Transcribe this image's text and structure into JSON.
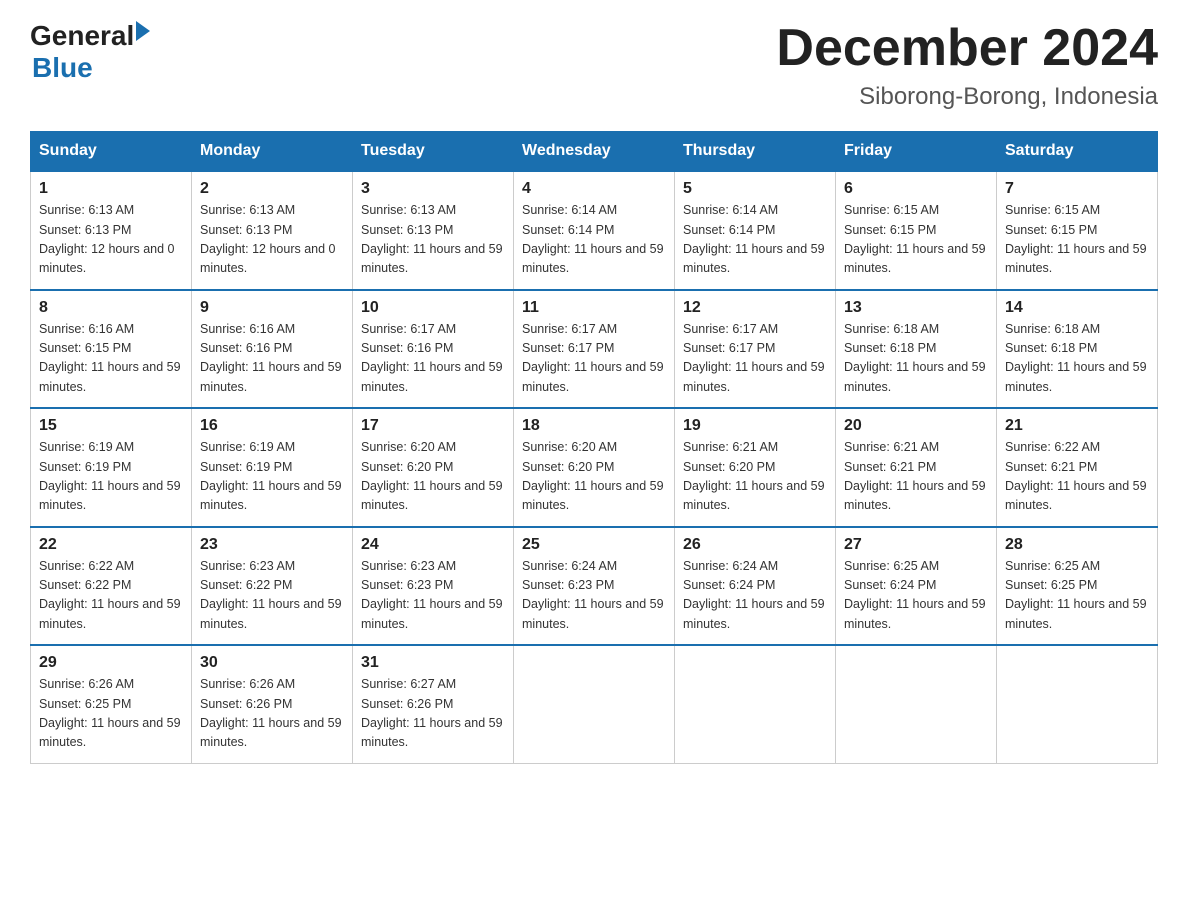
{
  "logo": {
    "general": "General",
    "arrow": "▶",
    "blue": "Blue"
  },
  "title": {
    "month": "December 2024",
    "location": "Siborong-Borong, Indonesia"
  },
  "headers": [
    "Sunday",
    "Monday",
    "Tuesday",
    "Wednesday",
    "Thursday",
    "Friday",
    "Saturday"
  ],
  "weeks": [
    [
      {
        "day": "1",
        "sunrise": "6:13 AM",
        "sunset": "6:13 PM",
        "daylight": "12 hours and 0 minutes."
      },
      {
        "day": "2",
        "sunrise": "6:13 AM",
        "sunset": "6:13 PM",
        "daylight": "12 hours and 0 minutes."
      },
      {
        "day": "3",
        "sunrise": "6:13 AM",
        "sunset": "6:13 PM",
        "daylight": "11 hours and 59 minutes."
      },
      {
        "day": "4",
        "sunrise": "6:14 AM",
        "sunset": "6:14 PM",
        "daylight": "11 hours and 59 minutes."
      },
      {
        "day": "5",
        "sunrise": "6:14 AM",
        "sunset": "6:14 PM",
        "daylight": "11 hours and 59 minutes."
      },
      {
        "day": "6",
        "sunrise": "6:15 AM",
        "sunset": "6:15 PM",
        "daylight": "11 hours and 59 minutes."
      },
      {
        "day": "7",
        "sunrise": "6:15 AM",
        "sunset": "6:15 PM",
        "daylight": "11 hours and 59 minutes."
      }
    ],
    [
      {
        "day": "8",
        "sunrise": "6:16 AM",
        "sunset": "6:15 PM",
        "daylight": "11 hours and 59 minutes."
      },
      {
        "day": "9",
        "sunrise": "6:16 AM",
        "sunset": "6:16 PM",
        "daylight": "11 hours and 59 minutes."
      },
      {
        "day": "10",
        "sunrise": "6:17 AM",
        "sunset": "6:16 PM",
        "daylight": "11 hours and 59 minutes."
      },
      {
        "day": "11",
        "sunrise": "6:17 AM",
        "sunset": "6:17 PM",
        "daylight": "11 hours and 59 minutes."
      },
      {
        "day": "12",
        "sunrise": "6:17 AM",
        "sunset": "6:17 PM",
        "daylight": "11 hours and 59 minutes."
      },
      {
        "day": "13",
        "sunrise": "6:18 AM",
        "sunset": "6:18 PM",
        "daylight": "11 hours and 59 minutes."
      },
      {
        "day": "14",
        "sunrise": "6:18 AM",
        "sunset": "6:18 PM",
        "daylight": "11 hours and 59 minutes."
      }
    ],
    [
      {
        "day": "15",
        "sunrise": "6:19 AM",
        "sunset": "6:19 PM",
        "daylight": "11 hours and 59 minutes."
      },
      {
        "day": "16",
        "sunrise": "6:19 AM",
        "sunset": "6:19 PM",
        "daylight": "11 hours and 59 minutes."
      },
      {
        "day": "17",
        "sunrise": "6:20 AM",
        "sunset": "6:20 PM",
        "daylight": "11 hours and 59 minutes."
      },
      {
        "day": "18",
        "sunrise": "6:20 AM",
        "sunset": "6:20 PM",
        "daylight": "11 hours and 59 minutes."
      },
      {
        "day": "19",
        "sunrise": "6:21 AM",
        "sunset": "6:20 PM",
        "daylight": "11 hours and 59 minutes."
      },
      {
        "day": "20",
        "sunrise": "6:21 AM",
        "sunset": "6:21 PM",
        "daylight": "11 hours and 59 minutes."
      },
      {
        "day": "21",
        "sunrise": "6:22 AM",
        "sunset": "6:21 PM",
        "daylight": "11 hours and 59 minutes."
      }
    ],
    [
      {
        "day": "22",
        "sunrise": "6:22 AM",
        "sunset": "6:22 PM",
        "daylight": "11 hours and 59 minutes."
      },
      {
        "day": "23",
        "sunrise": "6:23 AM",
        "sunset": "6:22 PM",
        "daylight": "11 hours and 59 minutes."
      },
      {
        "day": "24",
        "sunrise": "6:23 AM",
        "sunset": "6:23 PM",
        "daylight": "11 hours and 59 minutes."
      },
      {
        "day": "25",
        "sunrise": "6:24 AM",
        "sunset": "6:23 PM",
        "daylight": "11 hours and 59 minutes."
      },
      {
        "day": "26",
        "sunrise": "6:24 AM",
        "sunset": "6:24 PM",
        "daylight": "11 hours and 59 minutes."
      },
      {
        "day": "27",
        "sunrise": "6:25 AM",
        "sunset": "6:24 PM",
        "daylight": "11 hours and 59 minutes."
      },
      {
        "day": "28",
        "sunrise": "6:25 AM",
        "sunset": "6:25 PM",
        "daylight": "11 hours and 59 minutes."
      }
    ],
    [
      {
        "day": "29",
        "sunrise": "6:26 AM",
        "sunset": "6:25 PM",
        "daylight": "11 hours and 59 minutes."
      },
      {
        "day": "30",
        "sunrise": "6:26 AM",
        "sunset": "6:26 PM",
        "daylight": "11 hours and 59 minutes."
      },
      {
        "day": "31",
        "sunrise": "6:27 AM",
        "sunset": "6:26 PM",
        "daylight": "11 hours and 59 minutes."
      },
      null,
      null,
      null,
      null
    ]
  ]
}
